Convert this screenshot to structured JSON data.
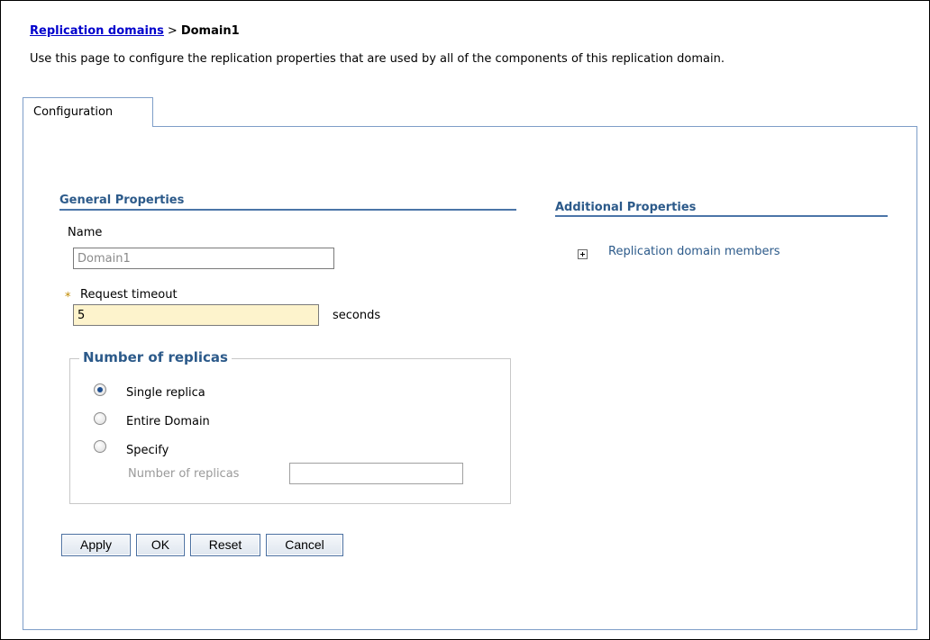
{
  "breadcrumb": {
    "parent_link": "Replication domains",
    "separator": ">",
    "current": "Domain1"
  },
  "description": "Use this page to configure the replication properties that are used by all of the components of this replication domain.",
  "tabs": [
    {
      "label": "Configuration"
    }
  ],
  "general": {
    "title": "General Properties",
    "name_label": "Name",
    "name_value": "Domain1",
    "timeout_label": "Request timeout",
    "timeout_required_mark": "*",
    "timeout_value": "5",
    "timeout_unit": "seconds"
  },
  "replicas": {
    "legend": "Number of replicas",
    "options": [
      {
        "label": "Single replica",
        "checked": true
      },
      {
        "label": "Entire Domain",
        "checked": false
      },
      {
        "label": "Specify",
        "checked": false
      }
    ],
    "count_label": "Number of replicas",
    "count_value": ""
  },
  "buttons": {
    "apply": "Apply",
    "ok": "OK",
    "reset": "Reset",
    "cancel": "Cancel"
  },
  "additional": {
    "title": "Additional Properties",
    "link": "Replication domain members"
  },
  "colors": {
    "accent": "#2c5a8a",
    "link": "#0000cc",
    "required_bg": "#fdf3cc",
    "border": "#7e9ec8"
  }
}
